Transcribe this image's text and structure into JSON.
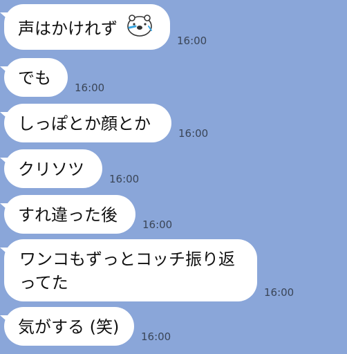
{
  "messages": [
    {
      "text": "声はかけれず",
      "time": "16:00",
      "emoji": "bear-sticker-icon"
    },
    {
      "text": "でも",
      "time": "16:00"
    },
    {
      "text": "しっぽとか顔とか",
      "time": "16:00"
    },
    {
      "text": "クリソツ",
      "time": "16:00"
    },
    {
      "text": "すれ違った後",
      "time": "16:00"
    },
    {
      "text_line1": "ワンコもずっとコッチ振り返",
      "text_line2": "ってた",
      "time": "16:00"
    },
    {
      "text": "気がする (笑)",
      "time": "16:00"
    }
  ],
  "colors": {
    "background": "#8aa6d9",
    "bubble": "#ffffff",
    "time_text": "#3a4557"
  }
}
